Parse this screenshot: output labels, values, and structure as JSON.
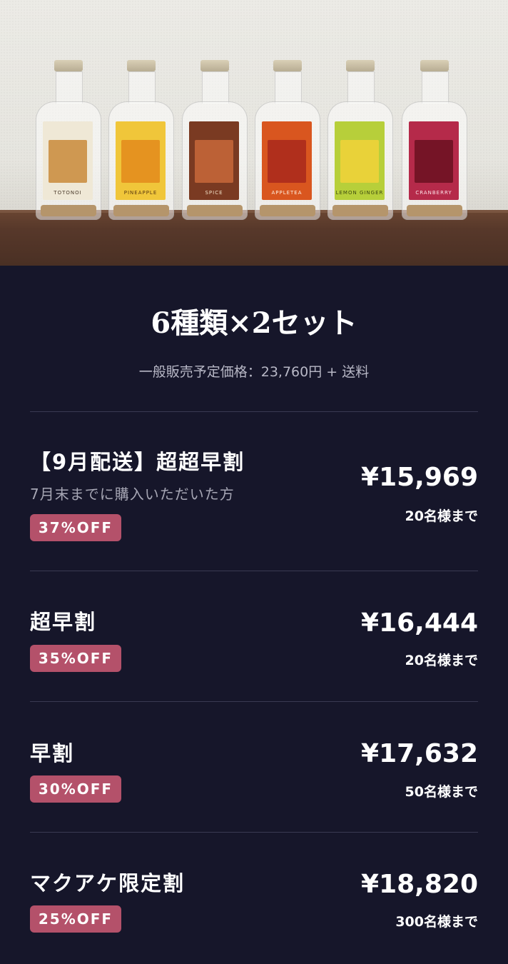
{
  "hero": {
    "bottles": [
      {
        "label": "TOTONOI",
        "color": "#efe8d6",
        "accent": "#c98a3a",
        "text": "#4a3a2a"
      },
      {
        "label": "PINEAPPLE",
        "color": "#f0c63a",
        "accent": "#e38a1c",
        "text": "#5a3a10"
      },
      {
        "label": "SPICE",
        "color": "#7a3a22",
        "accent": "#c8693a",
        "text": "#f2e2c8"
      },
      {
        "label": "APPLETEA",
        "color": "#d9561f",
        "accent": "#a8281c",
        "text": "#fff0e0"
      },
      {
        "label": "LEMON GINGER",
        "color": "#b7cf3a",
        "accent": "#f2d23a",
        "text": "#3e4a10"
      },
      {
        "label": "CRANBERRY",
        "color": "#b52a4a",
        "accent": "#6a1020",
        "text": "#fde2e8"
      }
    ]
  },
  "header": {
    "title": "6種類×2セット",
    "subtitle": "一般販売予定価格：23,760円 + 送料"
  },
  "plans": [
    {
      "name": "【9月配送】超超早割",
      "note": "7月末までに購入いただいた方",
      "discount": "37%OFF",
      "price": "¥15,969",
      "limit": "20名様まで"
    },
    {
      "name": "超早割",
      "discount": "35%OFF",
      "price": "¥16,444",
      "limit": "20名様まで"
    },
    {
      "name": "早割",
      "discount": "30%OFF",
      "price": "¥17,632",
      "limit": "50名様まで"
    },
    {
      "name": "マクアケ限定割",
      "discount": "25%OFF",
      "price": "¥18,820",
      "limit": "300名様まで"
    }
  ],
  "colors": {
    "background": "#16162a",
    "badge": "#b4516a",
    "divider": "#3a3a52"
  }
}
